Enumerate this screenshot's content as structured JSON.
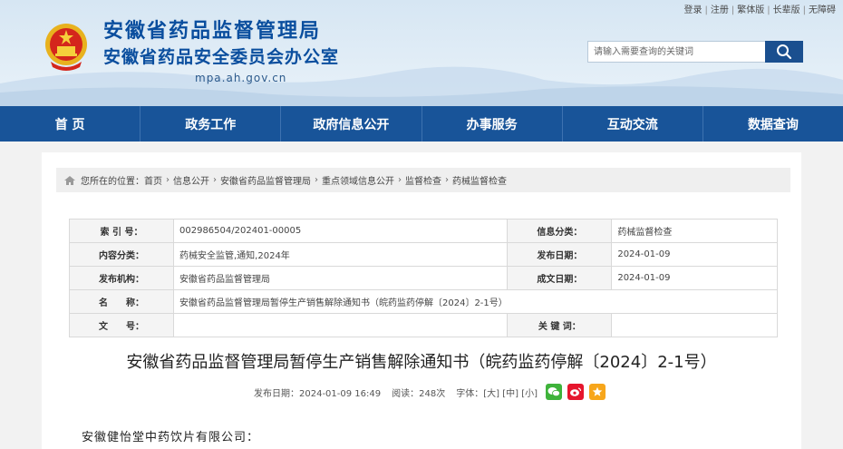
{
  "header": {
    "top_links": [
      "登录",
      "注册",
      "繁体版",
      "长辈版",
      "无障碍"
    ],
    "title_line1": "安徽省药品监督管理局",
    "title_line2": "安徽省药品安全委员会办公室",
    "domain": "mpa.ah.gov.cn",
    "search_placeholder": "请输入需要查询的关键词"
  },
  "icons": {
    "emblem": "national-emblem-icon",
    "search": "search-icon",
    "home": "home-icon",
    "wechat": "wechat-icon",
    "weibo": "weibo-icon",
    "favorite": "star-icon"
  },
  "colors": {
    "brand_blue": "#185499",
    "title_blue": "#0a4e9e",
    "wechat_green": "#3fb33b",
    "weibo_red": "#e6162d",
    "star_orange": "#f7a61b"
  },
  "nav": [
    "首 页",
    "政务工作",
    "政府信息公开",
    "办事服务",
    "互动交流",
    "数据查询"
  ],
  "breadcrumb": {
    "prefix": "您所在的位置：",
    "items": [
      "首页",
      "信息公开",
      "安徽省药品监督管理局",
      "重点领域信息公开",
      "监督检查",
      "药械监督检查"
    ]
  },
  "info": {
    "rows": [
      {
        "l1": "索 引 号：",
        "v1": "002986504/202401-00005",
        "l2": "信息分类：",
        "v2": "药械监督检查"
      },
      {
        "l1": "内容分类：",
        "v1": "药械安全监管,通知,2024年",
        "l2": "发布日期：",
        "v2": "2024-01-09"
      },
      {
        "l1": "发布机构：",
        "v1": "安徽省药品监督管理局",
        "l2": "成文日期：",
        "v2": "2024-01-09"
      }
    ],
    "name_label": "名　　称：",
    "name_value": "安徽省药品监督管理局暂停生产销售解除通知书（皖药监药停解〔2024〕2-1号）",
    "docno_label": "文　　号：",
    "docno_value": "",
    "keywords_label": "关 键 词：",
    "keywords_value": ""
  },
  "article": {
    "title": "安徽省药品监督管理局暂停生产销售解除通知书（皖药监药停解〔2024〕2-1号）",
    "published": "发布日期：2024-01-09 16:49",
    "views": "阅读：248次",
    "size_prefix": "字体：",
    "size_large": "[大]",
    "size_medium": "[中]",
    "size_small": "[小]",
    "body_first_line": "安徽健怡堂中药饮片有限公司："
  }
}
